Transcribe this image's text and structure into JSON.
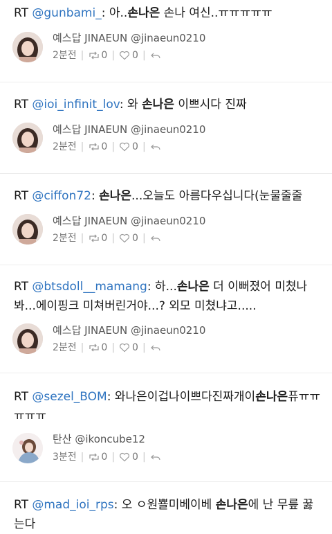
{
  "tweets": [
    {
      "rt": "RT",
      "handle": "@gunbami_",
      "colon": ":",
      "segments": [
        " 아..",
        "손나은",
        " 손나 여신..ㅠㅠㅠㅠㅠ"
      ],
      "user": "예스답 JINAEUN @jinaeun0210",
      "time": "2분전",
      "retweets": "0",
      "likes": "0"
    },
    {
      "rt": "RT",
      "handle": "@ioi_infinit_lov",
      "colon": ":",
      "segments": [
        " 와 ",
        "손나은",
        " 이쁘시다 진짜"
      ],
      "user": "예스답 JINAEUN @jinaeun0210",
      "time": "2분전",
      "retweets": "0",
      "likes": "0"
    },
    {
      "rt": "RT",
      "handle": "@ciffon72",
      "colon": ":",
      "segments": [
        " ",
        "손나은",
        "...오늘도 아름다우십니다(눈물줄줄"
      ],
      "user": "예스답 JINAEUN @jinaeun0210",
      "time": "2분전",
      "retweets": "0",
      "likes": "0"
    },
    {
      "rt": "RT",
      "handle": "@btsdoll__mamang",
      "colon": ":",
      "segments": [
        " 하...",
        "손나은",
        " 더 이뻐졌어 미쳤나 봐...에이핑크 미쳐버린거야...? 외모 미쳤냐고....."
      ],
      "user": "예스답 JINAEUN @jinaeun0210",
      "time": "2분전",
      "retweets": "0",
      "likes": "0"
    },
    {
      "rt": "RT",
      "handle": "@sezel_BOM",
      "colon": ":",
      "segments": [
        " 와나은이겁나이쁘다진짜개이",
        "손나은",
        "퓨ㅠㅠㅠㅠㅠ"
      ],
      "user": "탄산 @ikoncube12",
      "time": "3분전",
      "retweets": "0",
      "likes": "0"
    },
    {
      "rt": "RT",
      "handle": "@mad_ioi_rps",
      "colon": ":",
      "segments": [
        " 오 ㅇ원뾸미베이베 ",
        "손나은",
        "에 난 무릎 꿇는다"
      ],
      "user": "",
      "time": "",
      "retweets": "",
      "likes": ""
    }
  ],
  "colors": {
    "handle": "#2f74c0",
    "text": "#1a1a1a",
    "meta": "#777777",
    "separator": "#ececec"
  },
  "icons": {
    "retweet": "retweet-icon",
    "like": "heart-icon",
    "reply": "reply-icon"
  }
}
